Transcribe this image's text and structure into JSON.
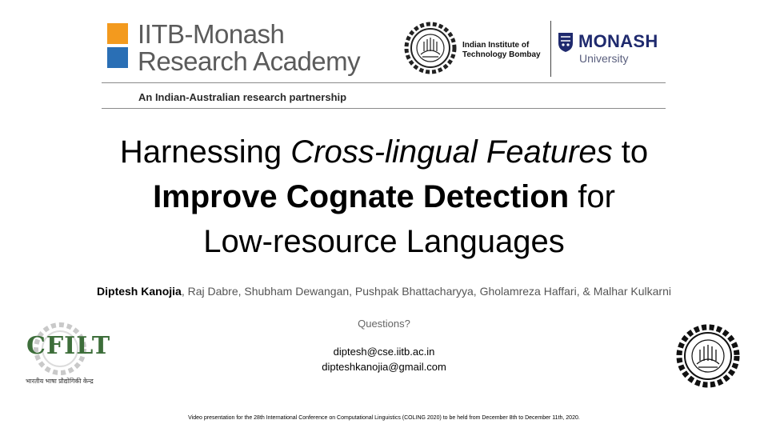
{
  "header": {
    "academy": {
      "line1": "IITB-Monash",
      "line2": "Research Academy",
      "tagline": "An Indian-Australian research partnership",
      "colors": {
        "orange": "#f39a1e",
        "blue": "#2a6fb5",
        "text": "#5b5b5b"
      }
    },
    "iitb": {
      "line1": "Indian Institute of",
      "line2": "Technology Bombay",
      "icon": "iitb-emblem-icon"
    },
    "monash": {
      "name": "MONASH",
      "sub": "University",
      "icon": "monash-shield-icon",
      "color": "#1f2a6e"
    }
  },
  "title": {
    "line1_pre": "Harnessing ",
    "line1_italic": "Cross-lingual Features",
    "line1_post": " to",
    "line2_bold": "Improve Cognate Detection",
    "line2_post": " for",
    "line3": "Low-resource Languages"
  },
  "authors": {
    "lead": "Diptesh Kanojia",
    "rest": ", Raj Dabre, Shubham Dewangan, Pushpak Bhattacharyya, Gholamreza Haffari, & Malhar Kulkarni"
  },
  "contact": {
    "questions": "Questions?",
    "email1": "diptesh@cse.iitb.ac.in",
    "email2": "dipteshkanojia@gmail.com"
  },
  "logos": {
    "cfilt_letters": "CFILT",
    "cfilt_caption": "भारतीय भाषा प्रौद्योगिकी केन्द्र",
    "cfilt_icon": "cfilt-gear-logo-icon",
    "iitb_icon": "iitb-gear-emblem-icon"
  },
  "footer": "Video presentation for the 28th International Conference on Computational Linguistics (COLING 2020) to be held from December 8th to December 11th, 2020."
}
